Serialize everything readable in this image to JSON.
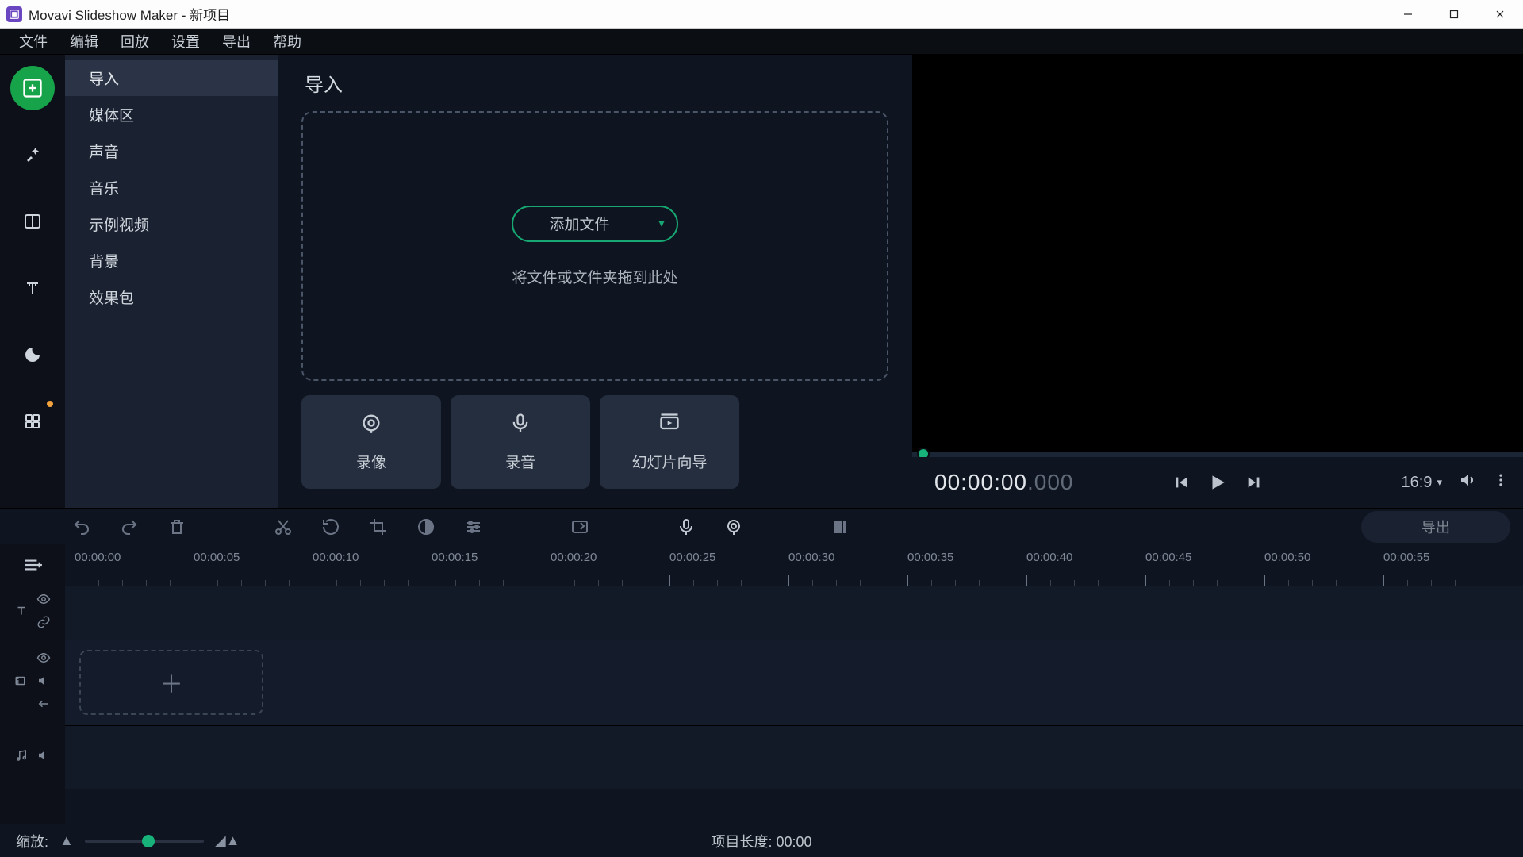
{
  "titlebar": {
    "app": "Movavi Slideshow Maker",
    "sep": " - ",
    "project": "新项目"
  },
  "menubar": [
    "文件",
    "编辑",
    "回放",
    "设置",
    "导出",
    "帮助"
  ],
  "vtools": [
    {
      "name": "import-tool",
      "icon": "plus-frame",
      "active": true
    },
    {
      "name": "filters-tool",
      "icon": "wand"
    },
    {
      "name": "transitions-tool",
      "icon": "split"
    },
    {
      "name": "titles-tool",
      "icon": "text"
    },
    {
      "name": "stickers-tool",
      "icon": "moon"
    },
    {
      "name": "more-tool",
      "icon": "grid",
      "dot": true
    }
  ],
  "sidepanel": {
    "items": [
      {
        "label": "导入",
        "active": true
      },
      {
        "label": "媒体区"
      },
      {
        "label": "声音"
      },
      {
        "label": "音乐"
      },
      {
        "label": "示例视频"
      },
      {
        "label": "背景"
      },
      {
        "label": "效果包"
      }
    ]
  },
  "center": {
    "title": "导入",
    "add_label": "添加文件",
    "drop_hint": "将文件或文件夹拖到此处",
    "cards": [
      {
        "name": "record-camera",
        "icon": "camera",
        "label": "录像"
      },
      {
        "name": "record-audio",
        "icon": "mic",
        "label": "录音"
      },
      {
        "name": "slideshow-wizard",
        "icon": "slideshow",
        "label": "幻灯片向导"
      }
    ]
  },
  "preview": {
    "timecode_main": "00:00:00",
    "timecode_ms": ".000",
    "aspect": "16:9"
  },
  "toolrow": {
    "export": "导出"
  },
  "timeline": {
    "ruler": [
      "00:00:00",
      "00:00:05",
      "00:00:10",
      "00:00:15",
      "00:00:20",
      "00:00:25",
      "00:00:30",
      "00:00:35",
      "00:00:40",
      "00:00:45",
      "00:00:50",
      "00:00:55"
    ]
  },
  "bottom": {
    "zoom_label": "缩放:",
    "project_length_label": "项目长度:",
    "project_length_value": "00:00"
  }
}
